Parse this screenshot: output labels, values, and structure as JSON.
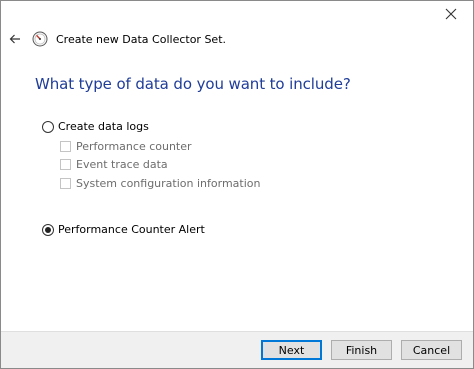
{
  "window": {
    "close_icon": "close-icon"
  },
  "header": {
    "back_icon": "arrow-left-icon",
    "app_icon": "performance-monitor-icon",
    "title": "Create new Data Collector Set."
  },
  "main": {
    "heading": "What type of data do you want to include?",
    "options": [
      {
        "type": "radio",
        "label": "Create data logs",
        "selected": false,
        "sub_items": [
          {
            "label": "Performance counter",
            "checked": false,
            "enabled": false
          },
          {
            "label": "Event trace data",
            "checked": false,
            "enabled": false
          },
          {
            "label": "System configuration information",
            "checked": false,
            "enabled": false
          }
        ]
      },
      {
        "type": "radio",
        "label": "Performance Counter Alert",
        "selected": true
      }
    ]
  },
  "footer": {
    "next_label": "Next",
    "finish_label": "Finish",
    "cancel_label": "Cancel"
  },
  "colors": {
    "heading": "#1f3d99",
    "default_button_border": "#0078d7",
    "footer_bg": "#f0f0f0"
  }
}
